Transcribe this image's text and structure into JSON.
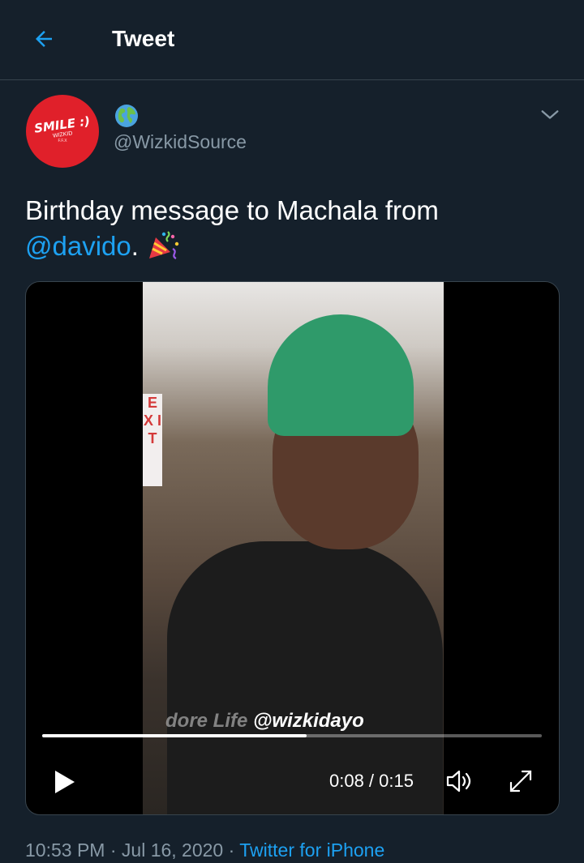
{
  "header": {
    "title": "Tweet"
  },
  "author": {
    "handle": "@WizkidSource",
    "avatar_text": "SMILE :)",
    "avatar_sub": "WIZKID",
    "avatar_sub2": "F.F.X"
  },
  "tweet": {
    "text": "Birthday message to Machala from",
    "mention": "@davido",
    "suffix": "."
  },
  "video": {
    "exit_sign": "E X I T",
    "watermark_faded": "dore Life",
    "watermark": "@wizkidayo",
    "progress": 0.53,
    "time": "0:08 / 0:15"
  },
  "meta": {
    "time": "10:53 PM",
    "date": "Jul 16, 2020",
    "sep": "·",
    "source": "Twitter for iPhone"
  },
  "colors": {
    "background": "#15202b",
    "accent": "#1da1f2",
    "muted": "#8899a6",
    "avatar": "#e0202a"
  },
  "icons": [
    "back-arrow-icon",
    "globe-icon",
    "chevron-down-icon",
    "party-popper-icon",
    "play-icon",
    "volume-icon",
    "fullscreen-icon"
  ]
}
